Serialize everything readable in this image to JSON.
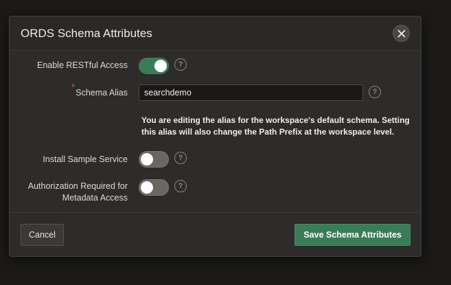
{
  "dialog": {
    "title": "ORDS Schema Attributes",
    "close_icon": "close-icon"
  },
  "fields": {
    "enable_restful": {
      "label": "Enable RESTful Access",
      "checked": true
    },
    "schema_alias": {
      "label": "Schema Alias",
      "required_marker": "*",
      "value": "searchdemo",
      "info_line1": "You are editing the alias for the workspace's default schema. Setting",
      "info_line2": "this alias will also change the Path Prefix at the workspace level."
    },
    "install_sample": {
      "label": "Install Sample Service",
      "checked": false
    },
    "auth_required": {
      "label_line1": "Authorization Required for",
      "label_line2": "Metadata Access",
      "checked": false
    },
    "help_glyph": "?"
  },
  "footer": {
    "cancel_label": "Cancel",
    "save_label": "Save Schema Attributes"
  },
  "colors": {
    "accent_green": "#3a7c57",
    "required_red": "#e5533d",
    "dialog_bg": "#2e2c2a"
  }
}
